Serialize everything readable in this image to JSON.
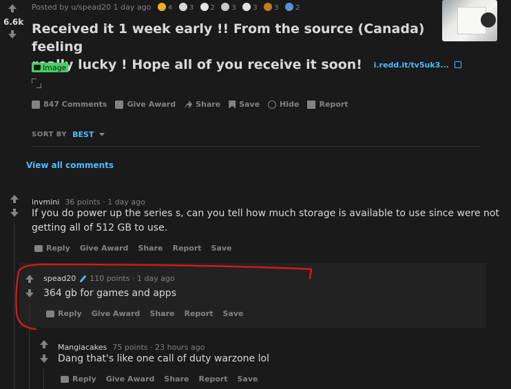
{
  "post": {
    "score": "6.6k",
    "posted_by": "Posted by u/spead20 1 day ago",
    "awards": [
      {
        "name": "award-1",
        "count": "4",
        "color": "#f0b01f"
      },
      {
        "name": "award-2",
        "count": "3",
        "color": "#d7dadc"
      },
      {
        "name": "award-3",
        "count": "2",
        "color": "#e3e5e7"
      },
      {
        "name": "award-4",
        "count": "3",
        "color": "#c9c9c9"
      },
      {
        "name": "award-5",
        "count": "3",
        "color": "#dfe1e3"
      },
      {
        "name": "award-6",
        "count": "3",
        "color": "#c37a1d"
      },
      {
        "name": "award-7",
        "count": "2",
        "color": "#5b8fd6"
      }
    ],
    "title_line1": "Received it 1 week early !! From the source (Canada) feeling",
    "title_line2": "really lucky ! Hope all of you receive it soon!",
    "link": "i.redd.it/tv5uk3...",
    "flair": "Image",
    "actions": {
      "comments": "847 Comments",
      "give_award": "Give Award",
      "share": "Share",
      "save": "Save",
      "hide": "Hide",
      "report": "Report"
    }
  },
  "sort": {
    "label": "SORT BY",
    "value": "BEST"
  },
  "view_all": "View all comments",
  "comments": [
    {
      "author": "invmini",
      "meta": "36 points · 1 day ago",
      "body_line1": "If you do power up the series s, can you tell how much storage is available to use since were not",
      "body_line2": "getting all of 512 GB to use.",
      "actions": {
        "reply": "Reply",
        "give_award": "Give Award",
        "share": "Share",
        "report": "Report",
        "save": "Save"
      }
    },
    {
      "author": "spead20",
      "meta": "110 points · 1 day ago",
      "body_line1": "364 gb for games and apps",
      "actions": {
        "reply": "Reply",
        "give_award": "Give Award",
        "share": "Share",
        "report": "Report",
        "save": "Save"
      }
    },
    {
      "author": "Mangiacakes",
      "meta": "75 points · 23 hours ago",
      "body_line1": "Dang that's like one call of duty warzone lol",
      "actions": {
        "reply": "Reply",
        "give_award": "Give Award",
        "share": "Share",
        "report": "Report",
        "save": "Save"
      }
    }
  ],
  "colors": {
    "annotation": "#d11a1a",
    "link": "#4fbcff",
    "flair_bg": "#46d160"
  }
}
